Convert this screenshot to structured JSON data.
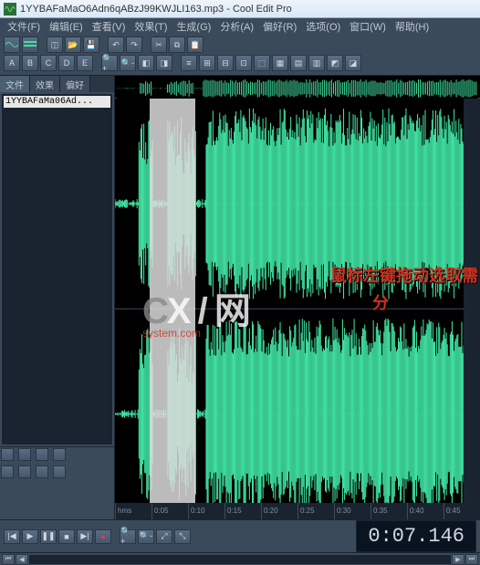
{
  "window": {
    "filename": "1YYBAFaMaO6Adn6qABzJ99KWJLI163.mp3",
    "app": "Cool Edit Pro"
  },
  "menu": [
    "文件(F)",
    "编辑(E)",
    "查看(V)",
    "效果(T)",
    "生成(G)",
    "分析(A)",
    "偏好(R)",
    "选项(O)",
    "窗口(W)",
    "帮助(H)"
  ],
  "sidebar": {
    "tabs": [
      "文件",
      "效果",
      "偏好"
    ],
    "files": [
      "1YYBAFaMa06Ad..."
    ]
  },
  "ruler": [
    "hms",
    "0:05",
    "0:10",
    "0:15",
    "0:20",
    "0:25",
    "0:30",
    "0:35",
    "0:40",
    "0:45"
  ],
  "annotation": {
    "l1": "鼠标左键拖动选取需",
    "l2": "分"
  },
  "watermark": {
    "top_grey": "C",
    "top_white": "X / 网",
    "sub": "system.com"
  },
  "time": "0:07.146",
  "icons": {
    "new": "◫",
    "open": "📂",
    "save": "💾",
    "undo": "↶",
    "redo": "↷",
    "cut": "✂",
    "copy": "⧉",
    "paste": "📋",
    "zoomin": "🔍+",
    "zoomout": "🔍-",
    "play": "▶",
    "pause": "❚❚",
    "stop": "■",
    "rec": "●",
    "rew": "⏮",
    "ffw": "⏭",
    "begin": "|◀",
    "end": "▶|",
    "left": "◀",
    "right": "▶"
  }
}
